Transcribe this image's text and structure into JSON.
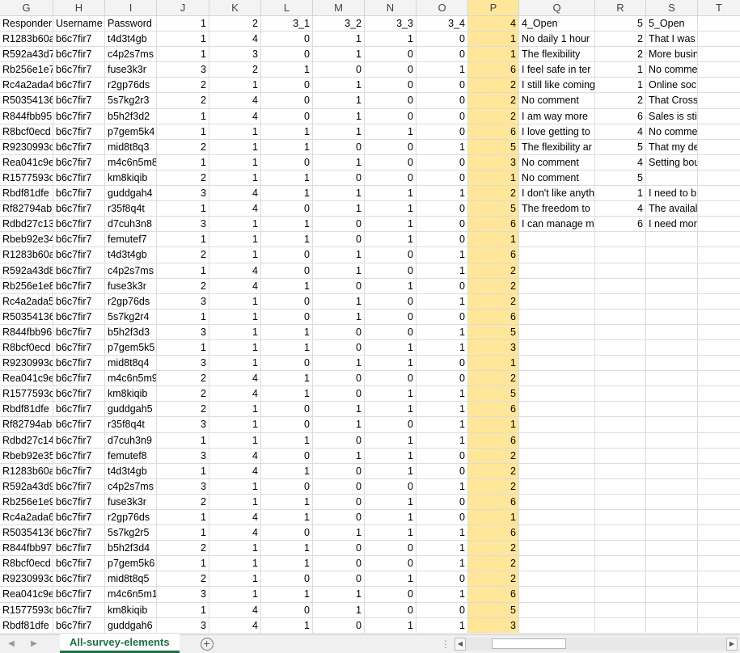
{
  "columns": [
    "G",
    "H",
    "I",
    "J",
    "K",
    "L",
    "M",
    "N",
    "O",
    "P",
    "Q",
    "R",
    "S",
    "T"
  ],
  "selected_col": 9,
  "numeric_cols": [
    3,
    4,
    5,
    6,
    7,
    8,
    9,
    11
  ],
  "rows": [
    [
      "Responder",
      "Username",
      "Password",
      "1",
      "2",
      "3_1",
      "3_2",
      "3_3",
      "3_4",
      "4",
      "4_Open",
      "5",
      "5_Open",
      ""
    ],
    [
      "R1283b60a",
      "b6c7fir7",
      "t4d3t4gb",
      "1",
      "4",
      "0",
      "1",
      "1",
      "0",
      "1",
      "No daily 1 hour",
      "2",
      "That I was",
      ""
    ],
    [
      "R592a43d7",
      "b6c7fir7",
      "c4p2s7ms",
      "1",
      "3",
      "0",
      "1",
      "0",
      "0",
      "1",
      "The flexibility",
      "2",
      "More busin",
      ""
    ],
    [
      "Rb256e1e7",
      "b6c7fir7",
      "fuse3k3r",
      "3",
      "2",
      "1",
      "0",
      "0",
      "1",
      "6",
      "I feel safe in ter",
      "1",
      "No comme",
      ""
    ],
    [
      "Rc4a2ada4",
      "b6c7fir7",
      "r2gp76ds",
      "2",
      "1",
      "0",
      "1",
      "0",
      "0",
      "2",
      "I still like coming",
      "1",
      "Online soc",
      ""
    ],
    [
      "R50354136",
      "b6c7fir7",
      "5s7kg2r3",
      "2",
      "4",
      "0",
      "1",
      "0",
      "0",
      "2",
      "No comment",
      "2",
      "That Cross",
      ""
    ],
    [
      "R844fbb95",
      "b6c7fir7",
      "b5h2f3d2",
      "1",
      "4",
      "0",
      "1",
      "0",
      "0",
      "2",
      "I am way more",
      "6",
      "Sales is stil",
      ""
    ],
    [
      "R8bcf0ecd",
      "b6c7fir7",
      "p7gem5k4",
      "1",
      "1",
      "1",
      "1",
      "1",
      "0",
      "6",
      "I love getting to",
      "4",
      "No comme",
      ""
    ],
    [
      "R9230993c",
      "b6c7fir7",
      "mid8t8q3",
      "2",
      "1",
      "1",
      "0",
      "0",
      "1",
      "5",
      "The flexibility ar",
      "5",
      "That my de",
      ""
    ],
    [
      "Rea041c9e",
      "b6c7fir7",
      "m4c6n5m8",
      "1",
      "1",
      "0",
      "1",
      "0",
      "0",
      "3",
      "No comment",
      "4",
      "Setting bou",
      ""
    ],
    [
      "R1577593c",
      "b6c7fir7",
      "km8kiqib",
      "2",
      "1",
      "1",
      "0",
      "0",
      "0",
      "1",
      "No comment",
      "5",
      "",
      ""
    ],
    [
      "Rbdf81dfe",
      "b6c7fir7",
      "guddgah4",
      "3",
      "4",
      "1",
      "1",
      "1",
      "1",
      "2",
      "I don't like anyth",
      "1",
      "I need to b",
      ""
    ],
    [
      "Rf82794ab",
      "b6c7fir7",
      "r35f8q4t",
      "1",
      "4",
      "0",
      "1",
      "1",
      "0",
      "5",
      "The freedom to",
      "4",
      "The availal",
      ""
    ],
    [
      "Rdbd27c13",
      "b6c7fir7",
      "d7cuh3n8",
      "3",
      "1",
      "1",
      "0",
      "1",
      "0",
      "6",
      "I can manage m",
      "6",
      "I need mor",
      ""
    ],
    [
      "Rbeb92e34",
      "b6c7fir7",
      "femutef7",
      "1",
      "1",
      "1",
      "0",
      "1",
      "0",
      "1",
      "",
      "",
      "",
      ""
    ],
    [
      "R1283b60a",
      "b6c7fir7",
      "t4d3t4gb",
      "2",
      "1",
      "0",
      "1",
      "0",
      "1",
      "6",
      "",
      "",
      "",
      ""
    ],
    [
      "R592a43d8",
      "b6c7fir7",
      "c4p2s7ms",
      "1",
      "4",
      "0",
      "1",
      "0",
      "1",
      "2",
      "",
      "",
      "",
      ""
    ],
    [
      "Rb256e1e8",
      "b6c7fir7",
      "fuse3k3r",
      "2",
      "4",
      "1",
      "0",
      "1",
      "0",
      "2",
      "",
      "",
      "",
      ""
    ],
    [
      "Rc4a2ada5",
      "b6c7fir7",
      "r2gp76ds",
      "3",
      "1",
      "0",
      "1",
      "0",
      "1",
      "2",
      "",
      "",
      "",
      ""
    ],
    [
      "R50354136",
      "b6c7fir7",
      "5s7kg2r4",
      "1",
      "1",
      "0",
      "1",
      "0",
      "0",
      "6",
      "",
      "",
      "",
      ""
    ],
    [
      "R844fbb96",
      "b6c7fir7",
      "b5h2f3d3",
      "3",
      "1",
      "1",
      "0",
      "0",
      "1",
      "5",
      "",
      "",
      "",
      ""
    ],
    [
      "R8bcf0ecd",
      "b6c7fir7",
      "p7gem5k5",
      "1",
      "1",
      "1",
      "0",
      "1",
      "1",
      "3",
      "",
      "",
      "",
      ""
    ],
    [
      "R9230993c",
      "b6c7fir7",
      "mid8t8q4",
      "3",
      "1",
      "0",
      "1",
      "1",
      "0",
      "1",
      "",
      "",
      "",
      ""
    ],
    [
      "Rea041c9e",
      "b6c7fir7",
      "m4c6n5m9",
      "2",
      "4",
      "1",
      "0",
      "0",
      "0",
      "2",
      "",
      "",
      "",
      ""
    ],
    [
      "R1577593c",
      "b6c7fir7",
      "km8kiqib",
      "2",
      "4",
      "1",
      "0",
      "1",
      "1",
      "5",
      "",
      "",
      "",
      ""
    ],
    [
      "Rbdf81dfe",
      "b6c7fir7",
      "guddgah5",
      "2",
      "1",
      "0",
      "1",
      "1",
      "1",
      "6",
      "",
      "",
      "",
      ""
    ],
    [
      "Rf82794ab",
      "b6c7fir7",
      "r35f8q4t",
      "3",
      "1",
      "0",
      "1",
      "0",
      "1",
      "1",
      "",
      "",
      "",
      ""
    ],
    [
      "Rdbd27c14",
      "b6c7fir7",
      "d7cuh3n9",
      "1",
      "1",
      "1",
      "0",
      "1",
      "1",
      "6",
      "",
      "",
      "",
      ""
    ],
    [
      "Rbeb92e35",
      "b6c7fir7",
      "femutef8",
      "3",
      "4",
      "0",
      "1",
      "1",
      "0",
      "2",
      "",
      "",
      "",
      ""
    ],
    [
      "R1283b60a",
      "b6c7fir7",
      "t4d3t4gb",
      "1",
      "4",
      "1",
      "0",
      "1",
      "0",
      "2",
      "",
      "",
      "",
      ""
    ],
    [
      "R592a43d9",
      "b6c7fir7",
      "c4p2s7ms",
      "3",
      "1",
      "0",
      "0",
      "0",
      "1",
      "2",
      "",
      "",
      "",
      ""
    ],
    [
      "Rb256e1e9",
      "b6c7fir7",
      "fuse3k3r",
      "2",
      "1",
      "1",
      "0",
      "1",
      "0",
      "6",
      "",
      "",
      "",
      ""
    ],
    [
      "Rc4a2ada6",
      "b6c7fir7",
      "r2gp76ds",
      "1",
      "4",
      "1",
      "0",
      "1",
      "0",
      "1",
      "",
      "",
      "",
      ""
    ],
    [
      "R50354136",
      "b6c7fir7",
      "5s7kg2r5",
      "1",
      "4",
      "0",
      "1",
      "1",
      "1",
      "6",
      "",
      "",
      "",
      ""
    ],
    [
      "R844fbb97",
      "b6c7fir7",
      "b5h2f3d4",
      "2",
      "1",
      "1",
      "0",
      "0",
      "1",
      "2",
      "",
      "",
      "",
      ""
    ],
    [
      "R8bcf0ecd",
      "b6c7fir7",
      "p7gem5k6",
      "1",
      "1",
      "1",
      "0",
      "0",
      "1",
      "2",
      "",
      "",
      "",
      ""
    ],
    [
      "R9230993c",
      "b6c7fir7",
      "mid8t8q5",
      "2",
      "1",
      "0",
      "0",
      "1",
      "0",
      "2",
      "",
      "",
      "",
      ""
    ],
    [
      "Rea041c9e",
      "b6c7fir7",
      "m4c6n5m1",
      "3",
      "1",
      "1",
      "1",
      "0",
      "1",
      "6",
      "",
      "",
      "",
      ""
    ],
    [
      "R1577593c",
      "b6c7fir7",
      "km8kiqib",
      "1",
      "4",
      "0",
      "1",
      "0",
      "0",
      "5",
      "",
      "",
      "",
      ""
    ],
    [
      "Rbdf81dfe",
      "b6c7fir7",
      "guddgah6",
      "3",
      "4",
      "1",
      "0",
      "1",
      "1",
      "3",
      "",
      "",
      "",
      ""
    ]
  ],
  "tabs": {
    "sheet_name": "All-survey-elements",
    "add_symbol": "+"
  },
  "icons": {
    "prev": "triangle-left-icon",
    "next": "triangle-right-icon",
    "add": "plus-circle-icon",
    "options": "vertical-dots-icon"
  },
  "colors": {
    "selected_column": "#ffe699",
    "tab_text": "#1e7145"
  }
}
